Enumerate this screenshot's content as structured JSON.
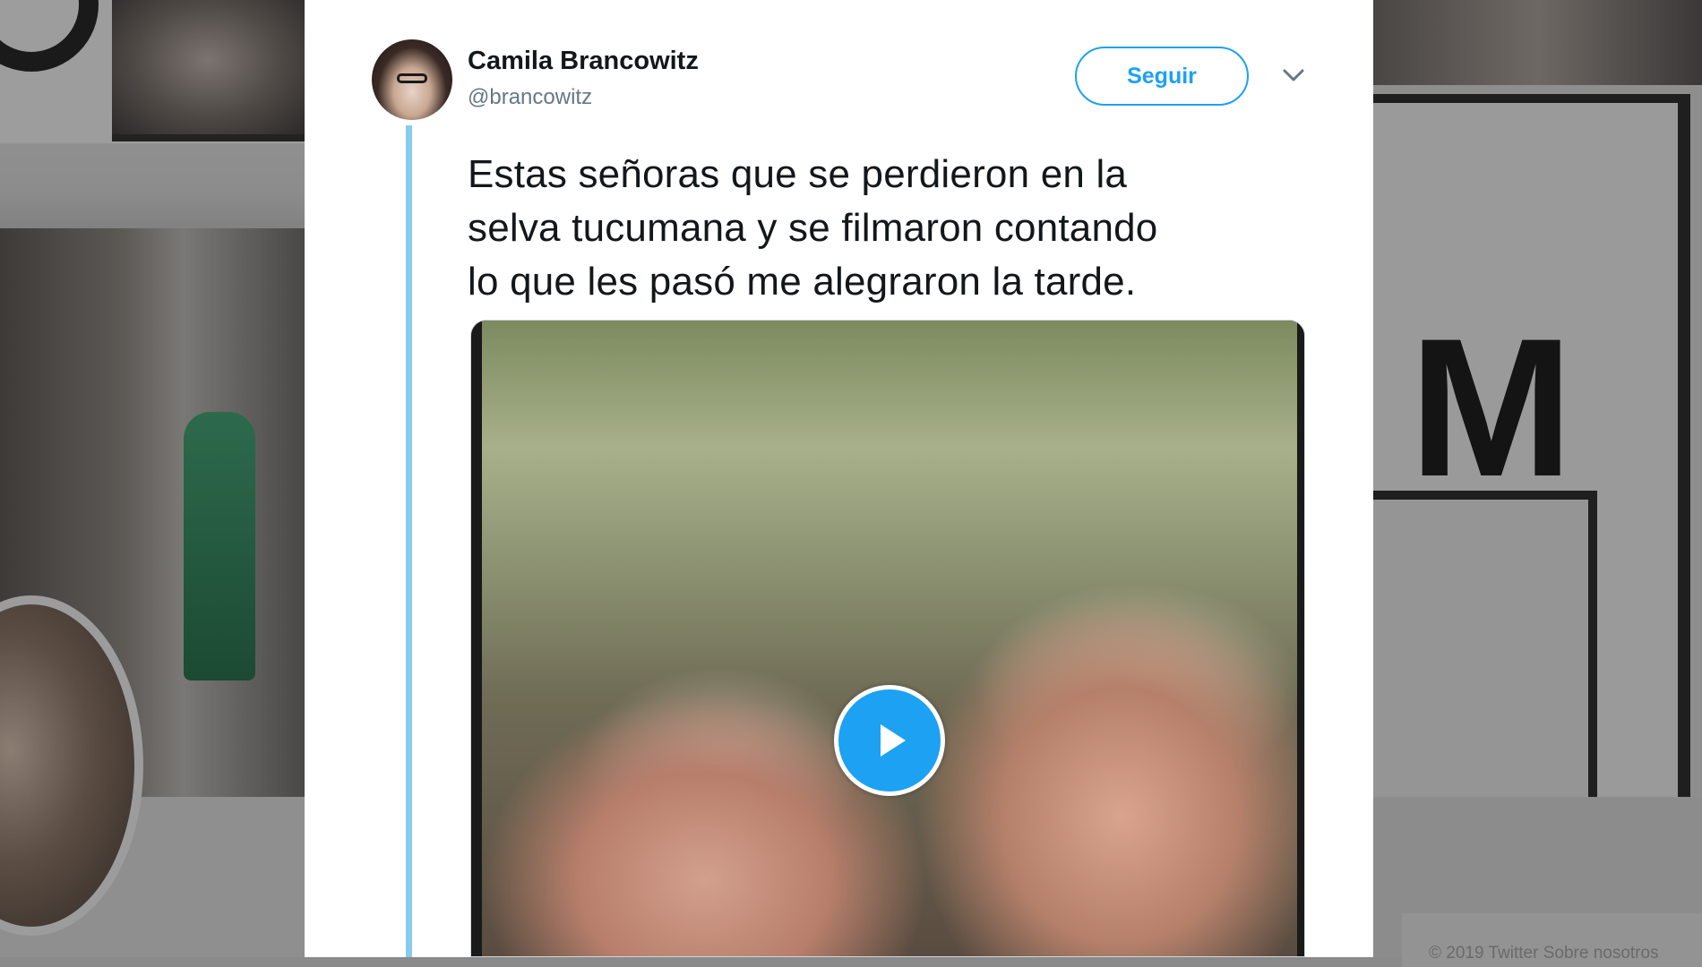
{
  "tweet": {
    "author": {
      "display_name": "Camila Brancowitz",
      "handle": "@brancowitz"
    },
    "follow_label": "Seguir",
    "text_lines": [
      "Estas señoras que se perdieron en la",
      "selva tucumana y se filmaron contando",
      "lo que les pasó me alegraron la tarde."
    ],
    "media": {
      "type": "video",
      "play_icon": "play-icon"
    }
  },
  "background": {
    "footer_text": "© 2019 Twitter   Sobre nosotros"
  },
  "colors": {
    "accent": "#1da1f2",
    "thread_line": "#86ccef",
    "text_primary": "#14171a",
    "text_secondary": "#657786"
  }
}
